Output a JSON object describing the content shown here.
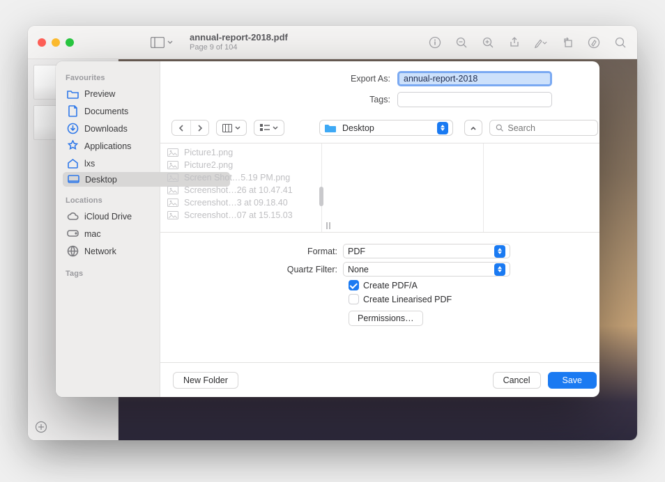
{
  "window": {
    "doc_title": "annual-report-2018.pdf",
    "page_status": "Page 9 of 104"
  },
  "export": {
    "label_export_as": "Export As:",
    "filename": "annual-report-2018",
    "label_tags": "Tags:",
    "tags_value": ""
  },
  "location": {
    "name": "Desktop"
  },
  "search": {
    "placeholder": "Search"
  },
  "sidebar": {
    "favourites_label": "Favourites",
    "locations_label": "Locations",
    "tags_label": "Tags",
    "items": [
      {
        "label": "Preview"
      },
      {
        "label": "Documents"
      },
      {
        "label": "Downloads"
      },
      {
        "label": "Applications"
      },
      {
        "label": "lxs"
      },
      {
        "label": "Desktop"
      }
    ],
    "locations": [
      {
        "label": "iCloud Drive"
      },
      {
        "label": "mac"
      },
      {
        "label": "Network"
      }
    ]
  },
  "files": [
    "Picture1.png",
    "Picture2.png",
    "Screen Shot…5.19 PM.png",
    "Screenshot…26 at 10.47.41",
    "Screenshot…3 at 09.18.40",
    "Screenshot…07 at 15.15.03"
  ],
  "options": {
    "format_label": "Format:",
    "format_value": "PDF",
    "quartz_label": "Quartz Filter:",
    "quartz_value": "None",
    "create_pdfa_label": "Create PDF/A",
    "create_pdfa_checked": true,
    "create_linear_label": "Create Linearised PDF",
    "create_linear_checked": false,
    "permissions_label": "Permissions…"
  },
  "footer": {
    "new_folder": "New Folder",
    "cancel": "Cancel",
    "save": "Save"
  }
}
